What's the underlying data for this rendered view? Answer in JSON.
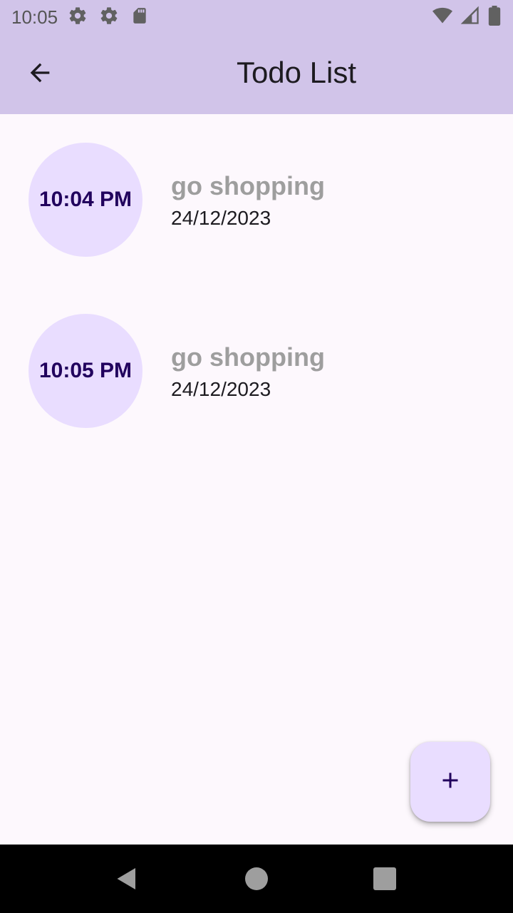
{
  "status_bar": {
    "time": "10:05",
    "left_icons": [
      "gear-icon",
      "gear-icon",
      "sd-card-icon"
    ],
    "right_icons": [
      "wifi-icon",
      "cell-signal-icon",
      "battery-icon"
    ]
  },
  "app_bar": {
    "title": "Todo List",
    "back_icon": "arrow-back-icon",
    "background": "#d1c4e9"
  },
  "todos": [
    {
      "time": "10:04 PM",
      "title": "go shopping",
      "date": "24/12/2023"
    },
    {
      "time": "10:05 PM",
      "title": "go shopping",
      "date": "24/12/2023"
    }
  ],
  "fab": {
    "icon": "plus-icon",
    "background": "#e9ddff"
  },
  "nav_bar": {
    "icons": [
      "nav-back-icon",
      "nav-home-icon",
      "nav-recents-icon"
    ]
  },
  "colors": {
    "accent": "#21005d",
    "circle_bg": "#e9ddff",
    "title_muted": "#9e9e9e",
    "page_bg": "#fdf8fd"
  }
}
